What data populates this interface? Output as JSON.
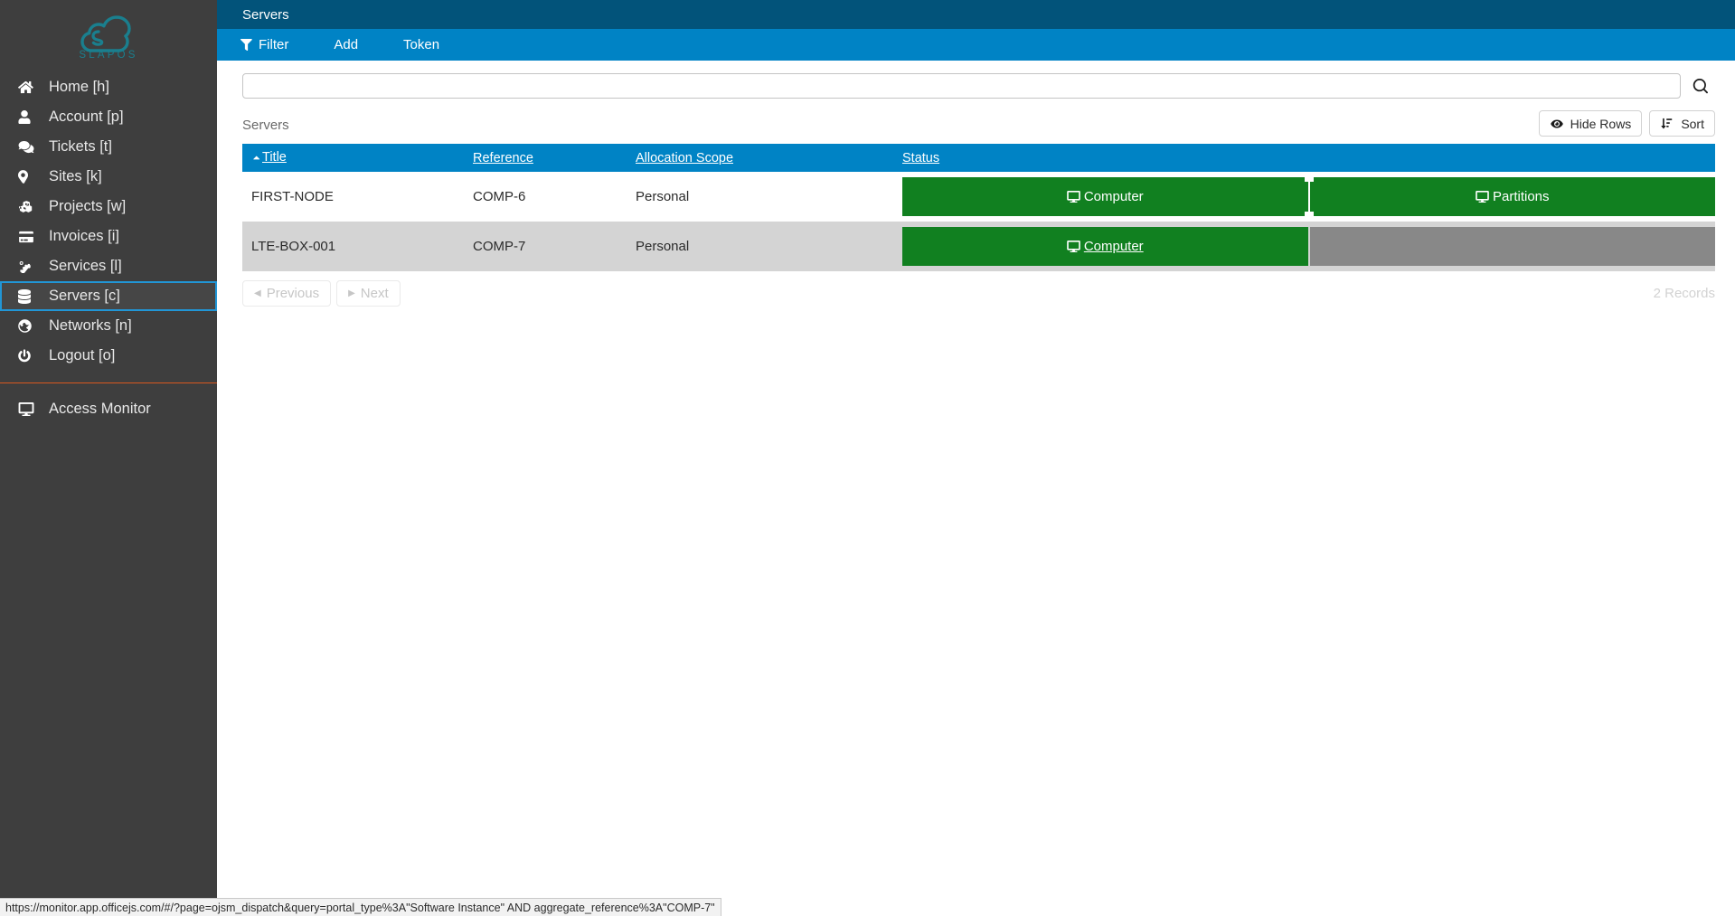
{
  "sidebar": {
    "logo_text": "SLAPOS",
    "logo_color": "#1a7f8e",
    "items": [
      {
        "label": "Home [h]",
        "icon": "home-icon",
        "selected": false
      },
      {
        "label": "Account [p]",
        "icon": "user-icon",
        "selected": false
      },
      {
        "label": "Tickets [t]",
        "icon": "comments-icon",
        "selected": false
      },
      {
        "label": "Sites [k]",
        "icon": "map-marker-icon",
        "selected": false
      },
      {
        "label": "Projects [w]",
        "icon": "cubes-icon",
        "selected": false
      },
      {
        "label": "Invoices [i]",
        "icon": "credit-card-icon",
        "selected": false
      },
      {
        "label": "Services [l]",
        "icon": "cogs-icon",
        "selected": false
      },
      {
        "label": "Servers [c]",
        "icon": "database-icon",
        "selected": true
      },
      {
        "label": "Networks [n]",
        "icon": "globe-icon",
        "selected": false
      },
      {
        "label": "Logout [o]",
        "icon": "power-off-icon",
        "selected": false
      }
    ],
    "footer_items": [
      {
        "label": "Access Monitor",
        "icon": "desktop-icon"
      }
    ],
    "separator_color": "#d9571e",
    "selected_border_color": "#2196d6",
    "background": "#3e3e3e"
  },
  "header": {
    "title": "Servers",
    "background": "#02537a"
  },
  "toolbar": {
    "background": "#0083c5",
    "items": [
      {
        "label": "Filter",
        "icon": "filter-icon"
      },
      {
        "label": "Add",
        "icon": ""
      },
      {
        "label": "Token",
        "icon": ""
      }
    ]
  },
  "search": {
    "value": "",
    "placeholder": "",
    "icon": "search-icon"
  },
  "listbox": {
    "caption": "Servers",
    "hide_rows_label": "Hide Rows",
    "hide_rows_icon": "eye-icon",
    "sort_label": "Sort",
    "sort_icon": "sort-amount-down-icon",
    "header_background": "#0083c5",
    "columns": [
      {
        "label": "Title",
        "sorted": true,
        "sort_direction": "asc"
      },
      {
        "label": "Reference",
        "sorted": false
      },
      {
        "label": "Allocation Scope",
        "sorted": false
      },
      {
        "label": "Status",
        "sorted": false
      }
    ],
    "rows": [
      {
        "title": "FIRST-NODE",
        "reference": "COMP-6",
        "allocation_scope": "Personal",
        "status_actions": [
          {
            "label": "Computer",
            "icon": "desktop-icon",
            "state": "active",
            "hovered": false
          },
          {
            "label": "Partitions",
            "icon": "desktop-icon",
            "state": "active",
            "hovered": false
          }
        ]
      },
      {
        "title": "LTE-BOX-001",
        "reference": "COMP-7",
        "allocation_scope": "Personal",
        "status_actions": [
          {
            "label": "Computer",
            "icon": "desktop-icon",
            "state": "active",
            "hovered": true
          },
          {
            "label": "",
            "icon": "",
            "state": "empty",
            "hovered": false
          }
        ]
      }
    ],
    "action_color_active": "#118020",
    "action_color_empty": "#888888"
  },
  "pagination": {
    "previous_label": "Previous",
    "next_label": "Next",
    "previous_enabled": false,
    "next_enabled": false,
    "records_label": "2 Records"
  },
  "statusbar": {
    "url": "https://monitor.app.officejs.com/#/?page=ojsm_dispatch&query=portal_type%3A\"Software Instance\" AND aggregate_reference%3A\"COMP-7\""
  }
}
